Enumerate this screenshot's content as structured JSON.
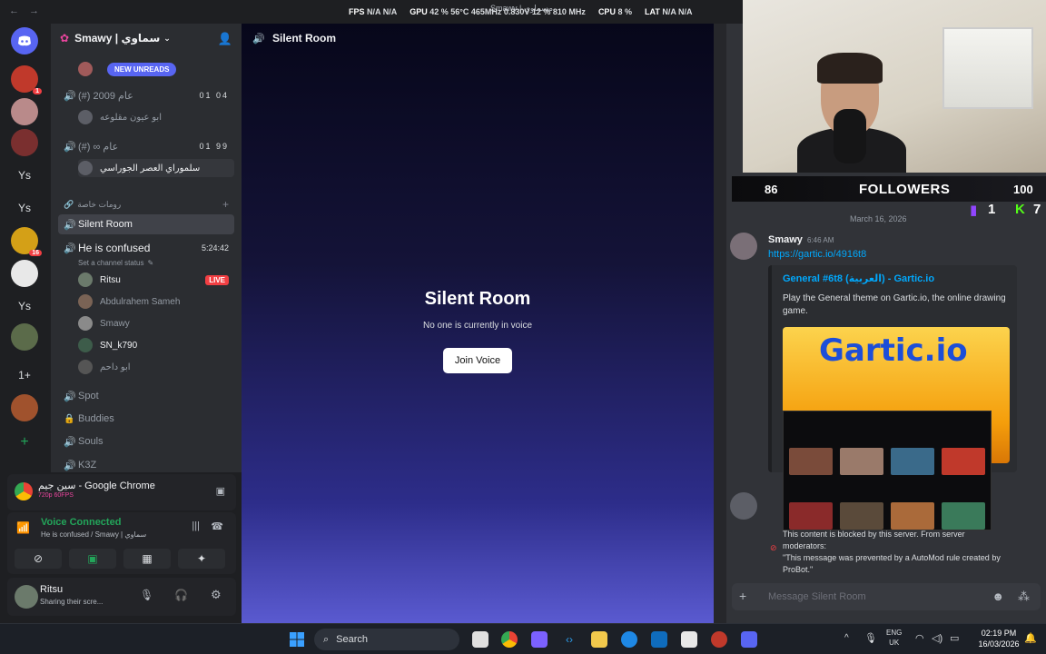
{
  "overlay": {
    "nav_arrows": "← →",
    "window_title": "Smawy | مسماوي",
    "stats": [
      {
        "label": "FPS",
        "value": "N/A  N/A"
      },
      {
        "label": "GPU",
        "value": "42 %  56°C  465MHz  0.830V  12 %  810 MHz"
      },
      {
        "label": "CPU",
        "value": "8 %"
      },
      {
        "label": "LAT",
        "value": "N/A  N/A"
      }
    ]
  },
  "rail": {
    "badges": [
      "1",
      "16"
    ],
    "labels": [
      "Ys",
      "Ys",
      "Ys",
      "1+",
      "+"
    ]
  },
  "server": {
    "name": "Smawy | سماوي",
    "new_unreads": "NEW UNREADS",
    "category": "رومات خاصة",
    "channels": [
      {
        "name": "(#) 2009 عام",
        "nums": "01 04"
      },
      {
        "name": "(#) ∞ عام",
        "nums": "01 99"
      }
    ],
    "users_top": [
      "ابو عيون مقلوعه",
      "سلموراي العصر الجوراسي"
    ],
    "active_channel": "Silent Room",
    "confused_channel": "He is confused",
    "confused_time": "5:24:42",
    "channel_status": "Set a channel status",
    "voice_users": [
      {
        "name": "Ritsu",
        "live": "LIVE"
      },
      {
        "name": "Abdulrahem Sameh",
        "live": ""
      },
      {
        "name": "Smawy",
        "live": ""
      },
      {
        "name": "SN_k790",
        "live": ""
      },
      {
        "name": "ابو داحم",
        "live": ""
      }
    ],
    "other_channels": [
      "Spot",
      "Buddies",
      "Souls",
      "K3Z"
    ]
  },
  "stream": {
    "title": "سين جيم - Google Chrome",
    "quality": "720p 60FPS"
  },
  "voice": {
    "status": "Voice Connected",
    "location": "He is confused / Smawy | سماوي"
  },
  "user": {
    "name": "Ritsu",
    "status": "Sharing their scre..."
  },
  "main": {
    "channel": "Silent Room",
    "title": "Silent Room",
    "subtitle": "No one is currently in voice",
    "join_label": "Join Voice"
  },
  "chat": {
    "followers_count": "86",
    "followers_label": "FOLLOWERS",
    "followers_total": "100",
    "twitch_count": "1",
    "kick_count": "7",
    "date_divider": "March 16, 2026",
    "author": "Smawy",
    "time": "6:46 AM",
    "link": "https://gartic.io/4916t8",
    "embed_title": "General #6t8 (العربية) - Gartic.io",
    "embed_desc": "Play the General theme on Gartic.io, the online drawing game.",
    "embed_logo": "Gartic.io",
    "blocked_line1": "This content is blocked by this server. From server",
    "blocked_line2": "moderators:",
    "blocked_line3": "\"This message was prevented by a AutoMod rule created by ProBot.\"",
    "placeholder": "Message Silent Room"
  },
  "taskbar": {
    "search_label": "Search",
    "lang_top": "ENG",
    "lang_bottom": "UK",
    "time": "02:19 PM",
    "date": "16/03/2026"
  },
  "colors": {
    "accent": "#5865f2",
    "live": "#f23f43",
    "connected": "#23a55a",
    "link": "#00a8fc"
  }
}
